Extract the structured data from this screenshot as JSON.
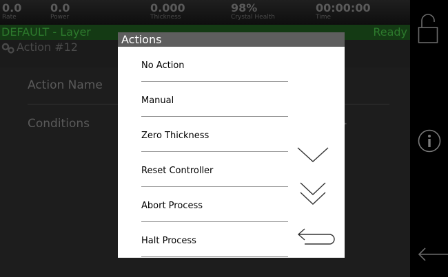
{
  "status": {
    "rate": {
      "value": "0.0",
      "label": "Rate"
    },
    "power": {
      "value": "0.0",
      "label": "Power"
    },
    "thickness": {
      "value": "0.000",
      "label": "Thickness"
    },
    "crystal": {
      "value": "98%",
      "label": "Crystal Health"
    },
    "time": {
      "value": "00:00:00",
      "label": "Time"
    }
  },
  "layer": {
    "name": "DEFAULT - Layer",
    "status": "Ready"
  },
  "action": {
    "title": "Action #12"
  },
  "form": {
    "name_label": "Action Name",
    "conditions_label": "Conditions",
    "conditions_tail": "}"
  },
  "modal": {
    "title": "Actions",
    "options": [
      "No Action",
      "Manual",
      "Zero Thickness",
      "Reset Controller",
      "Abort Process",
      "Halt Process"
    ]
  },
  "icons": {
    "lock": "lock-icon",
    "info": "info-icon",
    "back": "back-arrow-icon",
    "scroll_down": "chevron-down-icon",
    "page_down": "double-chevron-down-icon",
    "return": "return-icon"
  },
  "colors": {
    "layer_bar": "#143a14",
    "layer_text": "#2d7a2d",
    "modal_header": "#5e5e5e"
  }
}
